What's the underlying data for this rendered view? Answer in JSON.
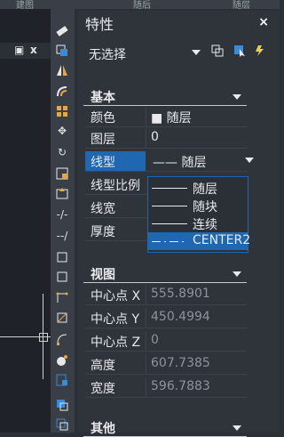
{
  "top_tabs": [
    "建图",
    "随后",
    "随层"
  ],
  "canvas": {
    "restore_icon": "restore-icon",
    "close_label": "x"
  },
  "tools": [
    "eraser-icon",
    "copy-icon",
    "mirror-icon",
    "offset-icon",
    "array-icon",
    "move-icon",
    "rotate-icon",
    "scale-icon",
    "stretch-icon",
    "trim-icon",
    "extend-icon",
    "break-icon",
    "join-icon",
    "chamfer-icon",
    "fillet-icon",
    "explode-icon"
  ],
  "panel": {
    "title": "特性",
    "close": "×",
    "selection": "无选择",
    "sections": {
      "basic": "基本",
      "view": "视图",
      "other": "其他"
    },
    "basic_rows": [
      {
        "key": "颜色",
        "value": "■ 随层"
      },
      {
        "key": "图层",
        "value": "0"
      },
      {
        "key": "线型",
        "value": "—— 随层"
      },
      {
        "key": "线型比例",
        "value": ""
      },
      {
        "key": "线宽",
        "value": ""
      },
      {
        "key": "厚度",
        "value": ""
      }
    ],
    "linetype_dropdown": [
      {
        "label": "随层",
        "selected": false
      },
      {
        "label": "随块",
        "selected": false
      },
      {
        "label": "连续",
        "selected": false
      },
      {
        "label": "CENTER2",
        "selected": true
      }
    ],
    "view_rows": [
      {
        "key": "中心点 X",
        "value": "555.8901"
      },
      {
        "key": "中心点 Y",
        "value": "450.4994"
      },
      {
        "key": "中心点 Z",
        "value": "0"
      },
      {
        "key": "高度",
        "value": "607.7385"
      },
      {
        "key": "宽度",
        "value": "596.7883"
      }
    ]
  }
}
